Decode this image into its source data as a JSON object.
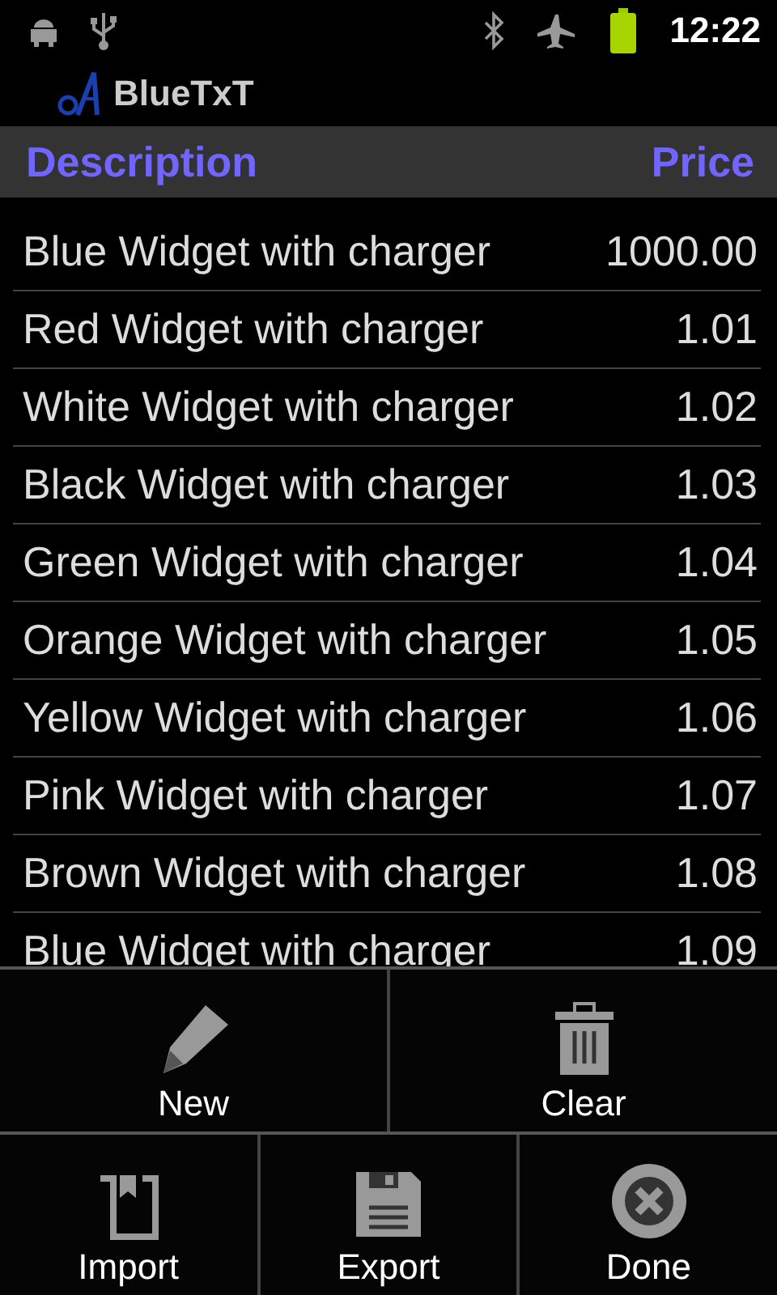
{
  "status_bar": {
    "time": "12:22"
  },
  "app_bar": {
    "title": "BlueTxT"
  },
  "table": {
    "columns": [
      "Description",
      "Price"
    ],
    "rows": [
      {
        "description": "Blue Widget with charger",
        "price": "1000.00"
      },
      {
        "description": "Red Widget with charger",
        "price": "1.01"
      },
      {
        "description": "White Widget with charger",
        "price": "1.02"
      },
      {
        "description": "Black Widget with charger",
        "price": "1.03"
      },
      {
        "description": "Green Widget with charger",
        "price": "1.04"
      },
      {
        "description": "Orange Widget with charger",
        "price": "1.05"
      },
      {
        "description": "Yellow Widget with charger",
        "price": "1.06"
      },
      {
        "description": "Pink Widget with charger",
        "price": "1.07"
      },
      {
        "description": "Brown Widget with charger",
        "price": "1.08"
      },
      {
        "description": "Blue Widget with charger",
        "price": "1.09"
      }
    ]
  },
  "options_menu": {
    "rows": [
      [
        {
          "label": "New"
        },
        {
          "label": "Clear"
        }
      ],
      [
        {
          "label": "Import"
        },
        {
          "label": "Export"
        },
        {
          "label": "Done"
        }
      ]
    ]
  }
}
